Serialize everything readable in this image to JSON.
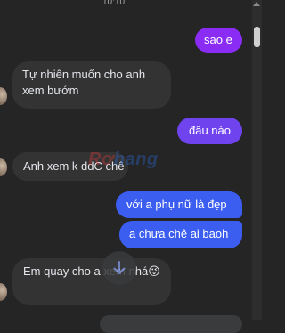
{
  "header": {
    "time": "10:10"
  },
  "colors": {
    "outgoing_purple": "#8a2cf4",
    "outgoing_violet": "#6f44ef",
    "outgoing_blue": "#3c5ef0",
    "incoming_bubble": "#333334",
    "background": "#252526"
  },
  "messages": [
    {
      "direction": "outgoing",
      "text": "sao e"
    },
    {
      "direction": "incoming",
      "text": "Tự nhiên muốn cho anh xem bướm"
    },
    {
      "direction": "outgoing",
      "text": "đâu nào"
    },
    {
      "direction": "incoming",
      "text": "Anh xem k ddC chê"
    },
    {
      "direction": "outgoing",
      "text": "với a phụ nữ là đẹp"
    },
    {
      "direction": "outgoing",
      "text": "a chưa chê ai baoh"
    },
    {
      "direction": "incoming",
      "text": "Em quay cho a xem nhá😜"
    }
  ],
  "watermark": {
    "part1": "Rơ",
    "part2": "hang"
  },
  "icons": {
    "scroll_down": "arrow-down-icon",
    "scroll_up": "scroll-up-arrow-icon"
  }
}
